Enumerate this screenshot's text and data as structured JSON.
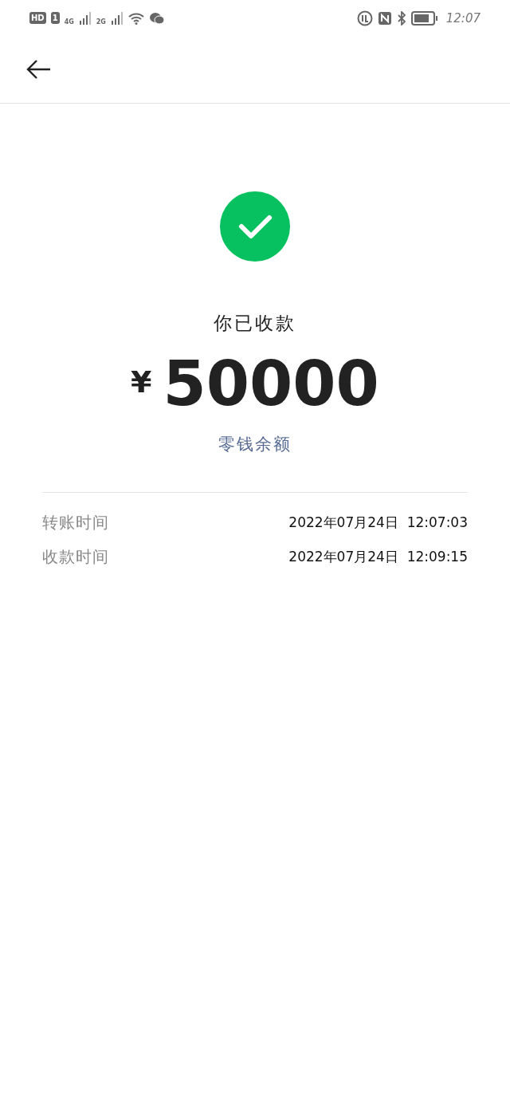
{
  "status_bar": {
    "hd_badge": "HD",
    "sim_badge": "1",
    "network_1": "4G",
    "network_2": "2G",
    "time": "12:07"
  },
  "result": {
    "succeeded": true,
    "title": "你已收款",
    "currency": "¥",
    "amount": "50000",
    "link": "零钱余额"
  },
  "details": [
    {
      "label": "转账时间",
      "value": "2022年07月24日  12:07:03"
    },
    {
      "label": "收款时间",
      "value": "2022年07月24日  12:09:15"
    }
  ]
}
